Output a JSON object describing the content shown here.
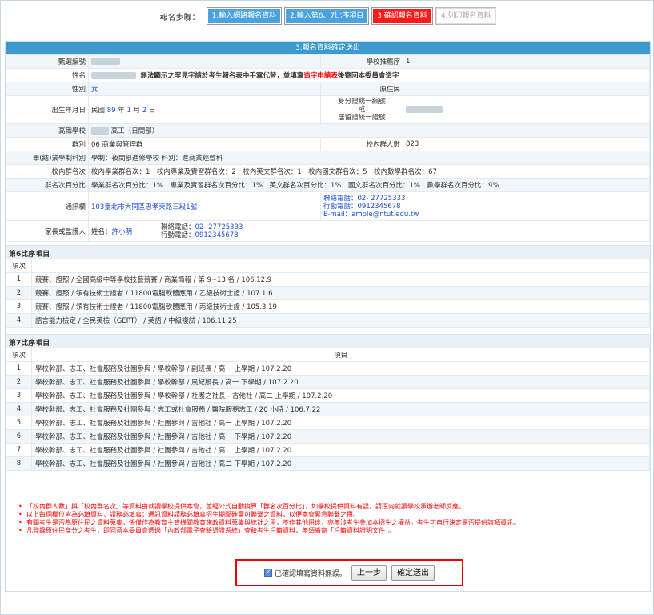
{
  "steps": {
    "label": "報名步驟：",
    "items": [
      {
        "label": "1.輸入網路報名資料",
        "state": "done"
      },
      {
        "label": "2.輸入第6、7比序項目",
        "state": "done"
      },
      {
        "label": "3.確認報名資料",
        "state": "current"
      },
      {
        "label": "4.列印報名資料",
        "state": "todo"
      }
    ]
  },
  "panel_title": "3.報名資料確定送出",
  "info": {
    "exam_no_label": "甄選編號",
    "school_rec_label": "學校推薦序",
    "school_rec_value": "1",
    "name_label": "姓名",
    "name_notice_prefix": "無法顯示之罕見字請於考生報名表中手寫代替，並填寫",
    "name_notice_link": "造字申請表",
    "name_notice_suffix": "後寄回本委員會造字",
    "gender_label": "性別",
    "gender_value": "女",
    "aborigine_label": "原住民",
    "birth_label": "出生年月日",
    "birth_pre": "民國 ",
    "birth_y": "89",
    "birth_mid1": " 年 ",
    "birth_m": "1",
    "birth_mid2": " 月 ",
    "birth_d": "2",
    "birth_post": " 日",
    "id_label_1": "身分證統一編號",
    "id_label_2": "或",
    "id_label_3": "居留證統一證號",
    "school_label": "高職學校",
    "school_value": "高工（日間部）",
    "group_label": "群別",
    "group_value": "06 商業與管理群",
    "school_count_label": "校內群人數",
    "school_count_value": "823",
    "grad_label": "畢(結)業學制科別",
    "grad_value": "學制：夜間部進修學校 科別：進商業經營科",
    "rank_label": "校內群名次",
    "rank_value": "校內學業群名次：1　校內專業及實習群名次：2　校內英文群名次：1　校內國文群名次：5　校內數學群名次：67",
    "pct_label": "群名次百分比",
    "pct_value": "學業群名次百分比：1%　專業及實習群名次百分比：1%　英文群名次百分比：1%　國文群名次百分比：1%　數學群名次百分比：9%",
    "addr_label": "通訊欄",
    "addr_value": "103臺北市大同區忠孝東路三段1號",
    "tel_label": "聯絡電話：",
    "tel_value": "02- 27725333",
    "mobile_label": "行動電話：",
    "mobile_value": "0912345678",
    "email_label": "E-mail：",
    "email_value": "ample@ntut.edu.tw",
    "guardian_label": "家長或監護人",
    "guardian_name_label": "姓名：",
    "guardian_name": "許小明",
    "g_tel_label": "聯絡電話：",
    "g_tel": "02- 27725333",
    "g_mobile_label": "行動電話：",
    "g_mobile": "0912345678"
  },
  "sec6": {
    "title": "第6比序項目",
    "col_no": "項次",
    "rows": [
      {
        "n": "1",
        "t": "競賽、證照 / 全國高級中等學校技藝競賽 / 商業簡報 / 第 9~13 名 / 106.12.9"
      },
      {
        "n": "2",
        "t": "競賽、證照 / 領有技術士證者 / 11800電腦軟體應用 / 乙級技術士證 / 107.1.6"
      },
      {
        "n": "3",
        "t": "競賽、證照 / 領有技術士證者 / 11800電腦軟體應用 / 丙級技術士證 / 105.3.19"
      },
      {
        "n": "4",
        "t": "語言能力檢定 / 全民英檢（GEPT） / 英語 / 中級複試 / 106.11.25"
      }
    ]
  },
  "sec7": {
    "title": "第7比序項目",
    "col_no": "項次",
    "col_item": "項目",
    "rows": [
      {
        "n": "1",
        "t": "學校幹部、志工、社會服務及社團參與 / 學校幹部 / 副班長 / 高一 上學期 / 107.2.20"
      },
      {
        "n": "2",
        "t": "學校幹部、志工、社會服務及社團參與 / 學校幹部 / 風紀股長 / 高一 下學期 / 107.2.20"
      },
      {
        "n": "3",
        "t": "學校幹部、志工、社會服務及社團參與 / 學校幹部 / 社團之社長 - 吉他社 / 高二 上學期 / 107.2.20"
      },
      {
        "n": "4",
        "t": "學校幹部、志工、社會服務及社團參與 / 志工或社會服務 / 醫院服務志工 / 20 小時 / 106.7.22"
      },
      {
        "n": "5",
        "t": "學校幹部、志工、社會服務及社團參與 / 社團參與 / 吉他社 / 高一 上學期 / 107.2.20"
      },
      {
        "n": "6",
        "t": "學校幹部、志工、社會服務及社團參與 / 社團參與 / 吉他社 / 高一 下學期 / 107.2.20"
      },
      {
        "n": "7",
        "t": "學校幹部、志工、社會服務及社團參與 / 社團參與 / 吉他社 / 高二 上學期 / 107.2.20"
      },
      {
        "n": "8",
        "t": "學校幹部、志工、社會服務及社團參與 / 社團參與 / 吉他社 / 高二 下學期 / 107.2.20"
      }
    ]
  },
  "notes": [
    "「校內群人數」與「校內群名次」等資料由就讀學校提供本會，並經公式自動換算「群名次百分比」，如學校提供資料有誤，請逕向就讀學校承辦老師反應。",
    "以上每個欄位皆為必填資料，請務必填寫；通訊資料請務必填寫招生期間確實可聯繫之資料，以便本會緊急聯繫之用。",
    "有關考生是否為原住民之資料蒐集，係僅作為教育主管機關教育施政資料蒐集與統計之用，不作其他用途，亦無涉考生參加本招生之權益。考生可自行決定是否提供該項資訊。",
    "凡登錄原住民身分之考生，即同意本委員會透過「內政部電子查驗憑證系統」查驗考生戶籍資料，無須繳寄「戶籍資料證明文件」。"
  ],
  "confirm": {
    "checkbox_label": "已確認填寫資料無誤。",
    "prev_label": "上一步",
    "submit_label": "確定送出"
  }
}
